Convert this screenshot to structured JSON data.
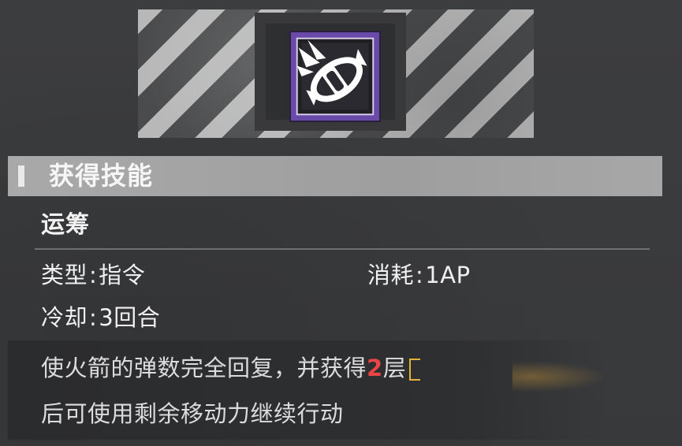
{
  "header": {
    "title": "获得技能"
  },
  "skill": {
    "name": "运筹",
    "icon": "rocket-refresh-icon",
    "type_label": "类型",
    "type_value": "指令",
    "cost_label": "消耗",
    "cost_value": "1AP",
    "cooldown_label": "冷却",
    "cooldown_value": "3回合"
  },
  "description": {
    "line1_before": "使火箭的弹数完全回复，并获得",
    "line1_highlight": "2",
    "line1_after": "层",
    "line2": "后可使用剩余移动力继续行动"
  },
  "colors": {
    "highlight": "#e94545",
    "icon_bg": "#6a4aa8",
    "keyword_frame": "#e2b23a"
  }
}
